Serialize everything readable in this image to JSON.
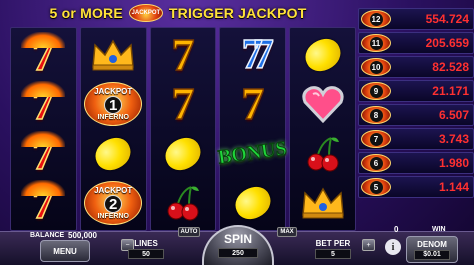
{
  "header": {
    "left_text": "5 or MORE",
    "badge_text": "JACKPOT",
    "right_text": "TRIGGER JACKPOT"
  },
  "reels": {
    "jackpot_word": "JACKPOT",
    "inferno_word": "INFERNO",
    "jackpot1_number": "1",
    "jackpot2_number": "2",
    "bonus_text": "BONUS",
    "seven_glyph": "7",
    "blue_seven_glyph": "77"
  },
  "jackpots": [
    {
      "level": "12",
      "amount": "554.724"
    },
    {
      "level": "11",
      "amount": "205.659"
    },
    {
      "level": "10",
      "amount": "82.528"
    },
    {
      "level": "9",
      "amount": "21.171"
    },
    {
      "level": "8",
      "amount": "6.507"
    },
    {
      "level": "7",
      "amount": "3.743"
    },
    {
      "level": "6",
      "amount": "1.980"
    },
    {
      "level": "5",
      "amount": "1.144"
    }
  ],
  "bottom": {
    "balance_label": "BALANCE",
    "balance_value": "500,000",
    "menu_label": "MENU",
    "lines_label": "LINES",
    "lines_value": "50",
    "auto_label": "AUTO",
    "spin_label": "SPIN",
    "spin_value": "250",
    "max_label": "MAX",
    "bet_label": "BET PER",
    "bet_value": "5",
    "win_value": "0",
    "win_label": "WIN",
    "denom_label": "DENOM",
    "denom_value": "$0.01",
    "info_glyph": "i",
    "minus_glyph": "−",
    "plus_glyph": "+"
  },
  "colors": {
    "jackpot_amount": "#ff3030",
    "header_text": "#ffe23a",
    "background": "#2a1060"
  }
}
